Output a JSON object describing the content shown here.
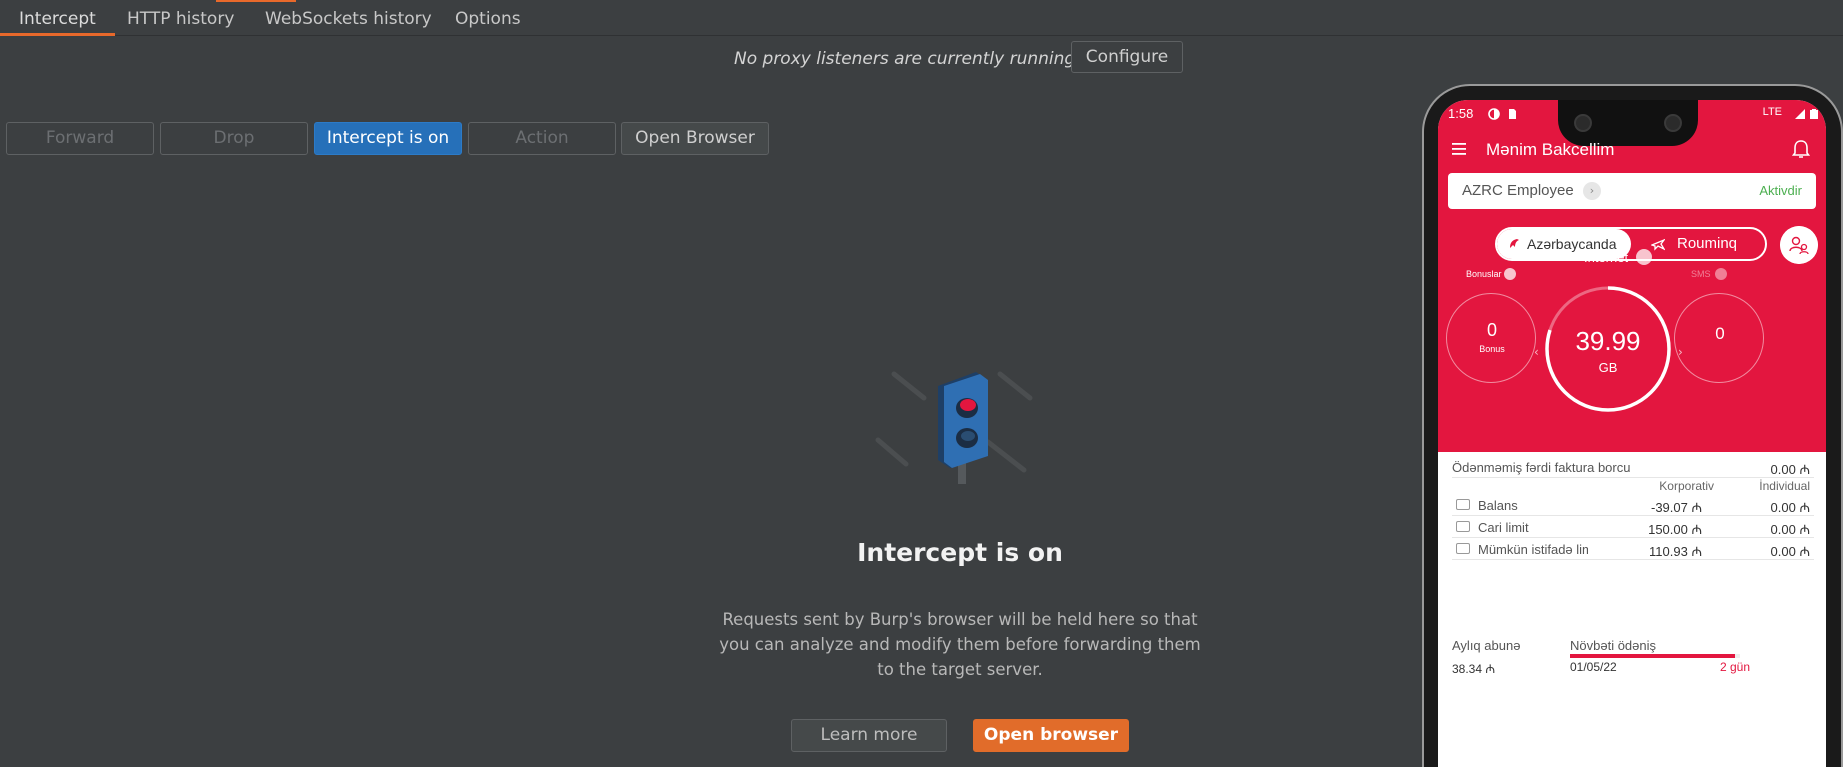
{
  "tabs": [
    {
      "label": "Intercept",
      "active": true
    },
    {
      "label": "HTTP history",
      "active": false
    },
    {
      "label": "WebSockets history",
      "active": false
    },
    {
      "label": "Options",
      "active": false
    }
  ],
  "proxy": {
    "message": "No proxy listeners are currently running",
    "configure_label": "Configure"
  },
  "toolbar": {
    "forward": "Forward",
    "drop": "Drop",
    "intercept": "Intercept is on",
    "action": "Action",
    "open_browser": "Open Browser"
  },
  "empty_state": {
    "title": "Intercept is on",
    "description": "Requests sent by Burp's browser will be held here so that you can analyze and modify them before forwarding them to the target server.",
    "learn_more": "Learn more",
    "open_browser": "Open browser"
  },
  "colors": {
    "accent": "#e8692b",
    "primary_button": "#2670b9",
    "app_red": "#e3163f",
    "status_active": "#4caf50"
  },
  "phone": {
    "status": {
      "time": "1:58",
      "network": "LTE"
    },
    "app_title": "Mənim Bakcellim",
    "plan": {
      "name": "AZRC Employee",
      "status": "Aktivdir"
    },
    "segments": {
      "domestic": "Azərbaycanda",
      "roaming": "Rouminq"
    },
    "balances": {
      "internet_label": "İnternet",
      "bonus_label": "Bonuslar",
      "sms_label": "SMS",
      "bonus_value": "0",
      "bonus_unit": "Bonus",
      "internet_value": "39.99",
      "internet_unit": "GB",
      "sms_value": "0"
    },
    "invoice": {
      "label": "Ödənməmiş fərdi faktura borcu",
      "value": "0.00 ₼"
    },
    "columns": {
      "corporate": "Korporativ",
      "individual": "İndividual"
    },
    "rows": [
      {
        "label": "Balans",
        "corporate": "-39.07 ₼",
        "individual": "0.00 ₼"
      },
      {
        "label": "Cari limit",
        "corporate": "150.00 ₼",
        "individual": "0.00 ₼"
      },
      {
        "label": "Mümkün istifadə limiti",
        "corporate": "110.93 ₼",
        "individual": "0.00 ₼"
      }
    ],
    "subscription": {
      "label": "Aylıq abunə",
      "value": "38.34 ₼"
    },
    "next_payment": {
      "label": "Növbəti ödəniş",
      "date": "01/05/22",
      "days_left": "2 gün",
      "progress_fraction": 0.97
    }
  }
}
